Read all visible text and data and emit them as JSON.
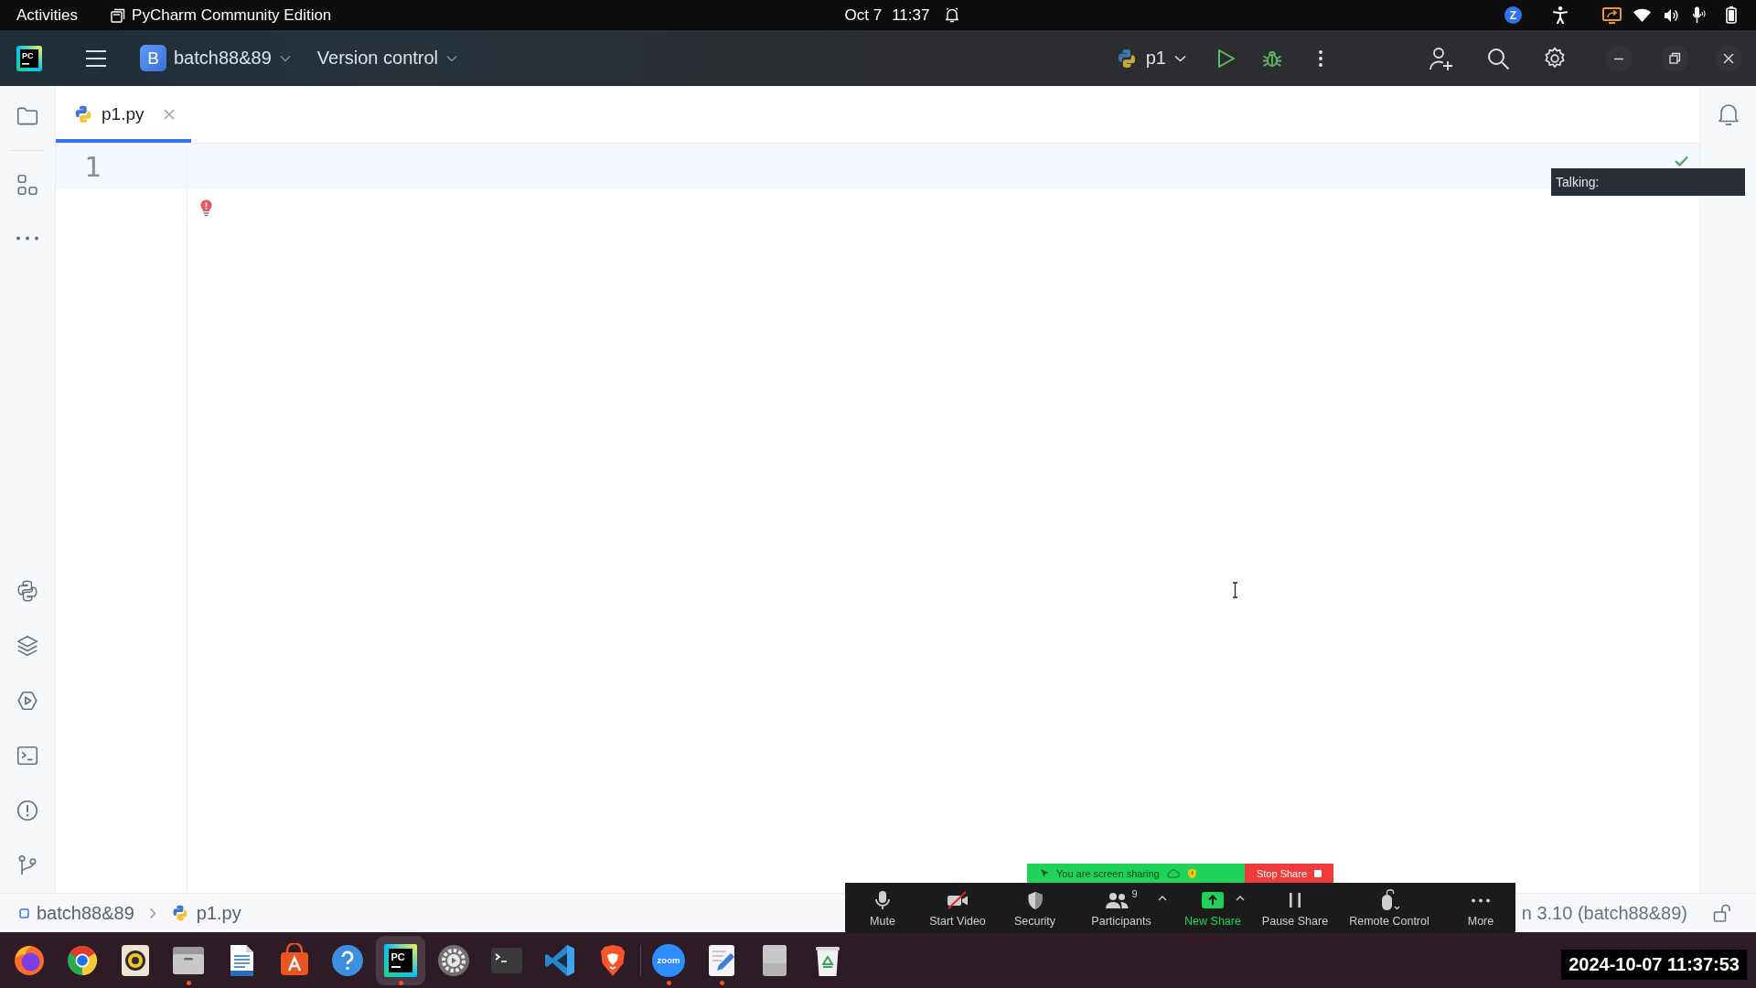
{
  "top_bar": {
    "activities": "Activities",
    "app_menu": "PyCharm Community Edition",
    "date": "Oct 7",
    "time": "11:37",
    "tray_letter": "Z"
  },
  "title_bar": {
    "logo": "PC",
    "project": {
      "badge": "B",
      "name": "batch88&89"
    },
    "vcs_menu": "Version control",
    "run_config": "p1"
  },
  "editor": {
    "tabs": [
      {
        "label": "p1.py",
        "selected": true
      }
    ],
    "line_numbers": [
      "1"
    ]
  },
  "breadcrumbs": [
    {
      "kind": "module",
      "label": "batch88&89"
    },
    {
      "kind": "python",
      "label": "p1.py"
    }
  ],
  "status_bar": {
    "interpreter": "n 3.10 (batch88&89)"
  },
  "zoom_overlay": {
    "tooltip": "Talking:",
    "banner": "You are screen sharing",
    "stop_button": "Stop Share",
    "buttons": [
      {
        "kind": "mute",
        "label": "Mute",
        "active": false,
        "menu": false
      },
      {
        "kind": "video",
        "label": "Start Video",
        "active": false,
        "menu": false
      },
      {
        "kind": "security",
        "label": "Security",
        "active": false,
        "menu": false
      },
      {
        "kind": "participants",
        "label": "Participants",
        "count": "9",
        "active": false,
        "menu": true
      },
      {
        "kind": "share",
        "label": "New Share",
        "active": true,
        "menu": true
      },
      {
        "kind": "pause",
        "label": "Pause Share",
        "active": false,
        "menu": false
      },
      {
        "kind": "remote",
        "label": "Remote Control",
        "active": false,
        "menu": false
      },
      {
        "kind": "more",
        "label": "More",
        "active": false,
        "menu": false
      }
    ]
  },
  "taskbar": {
    "pinned_apps": [
      {
        "kind": "firefox",
        "running": false,
        "selected": false
      },
      {
        "kind": "chrome",
        "running": false,
        "selected": false
      },
      {
        "kind": "rhythmbox",
        "running": false,
        "selected": false
      },
      {
        "kind": "files",
        "running": true,
        "selected": false
      },
      {
        "kind": "writer",
        "running": false,
        "selected": false
      },
      {
        "kind": "appcenter",
        "running": false,
        "selected": false
      },
      {
        "kind": "help",
        "running": false,
        "selected": false
      },
      {
        "kind": "pycharm",
        "label": "PC",
        "running": true,
        "selected": true
      },
      {
        "kind": "settings",
        "running": false,
        "selected": false
      },
      {
        "kind": "terminal",
        "running": false,
        "selected": false
      },
      {
        "kind": "vscode",
        "running": false,
        "selected": false
      },
      {
        "kind": "brave",
        "running": false,
        "selected": false
      }
    ],
    "other_apps": [
      {
        "kind": "zoom",
        "label": "zoom",
        "running": true,
        "selected": false
      },
      {
        "kind": "editor",
        "running": true,
        "selected": false
      },
      {
        "kind": "drive",
        "running": false,
        "selected": false
      },
      {
        "kind": "trash",
        "running": false,
        "selected": false
      }
    ],
    "clock": "2024-10-07 11:37:53"
  }
}
